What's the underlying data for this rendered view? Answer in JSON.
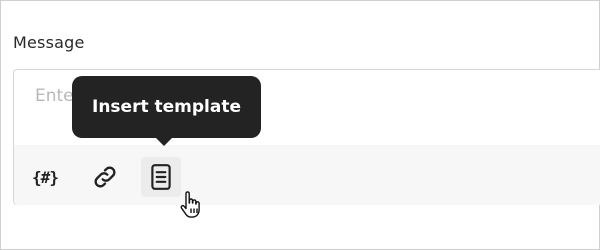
{
  "field": {
    "label": "Message",
    "placeholder": "Enter"
  },
  "toolbar": {
    "items": [
      {
        "name": "insert-variable",
        "glyph": "{#}",
        "icon": "variable-braces-icon"
      },
      {
        "name": "insert-link",
        "icon": "link-icon"
      },
      {
        "name": "insert-template",
        "icon": "document-template-icon",
        "hovered": true
      }
    ]
  },
  "tooltip": {
    "text": "Insert template"
  },
  "cursor": {
    "icon": "hand-pointer-icon"
  }
}
